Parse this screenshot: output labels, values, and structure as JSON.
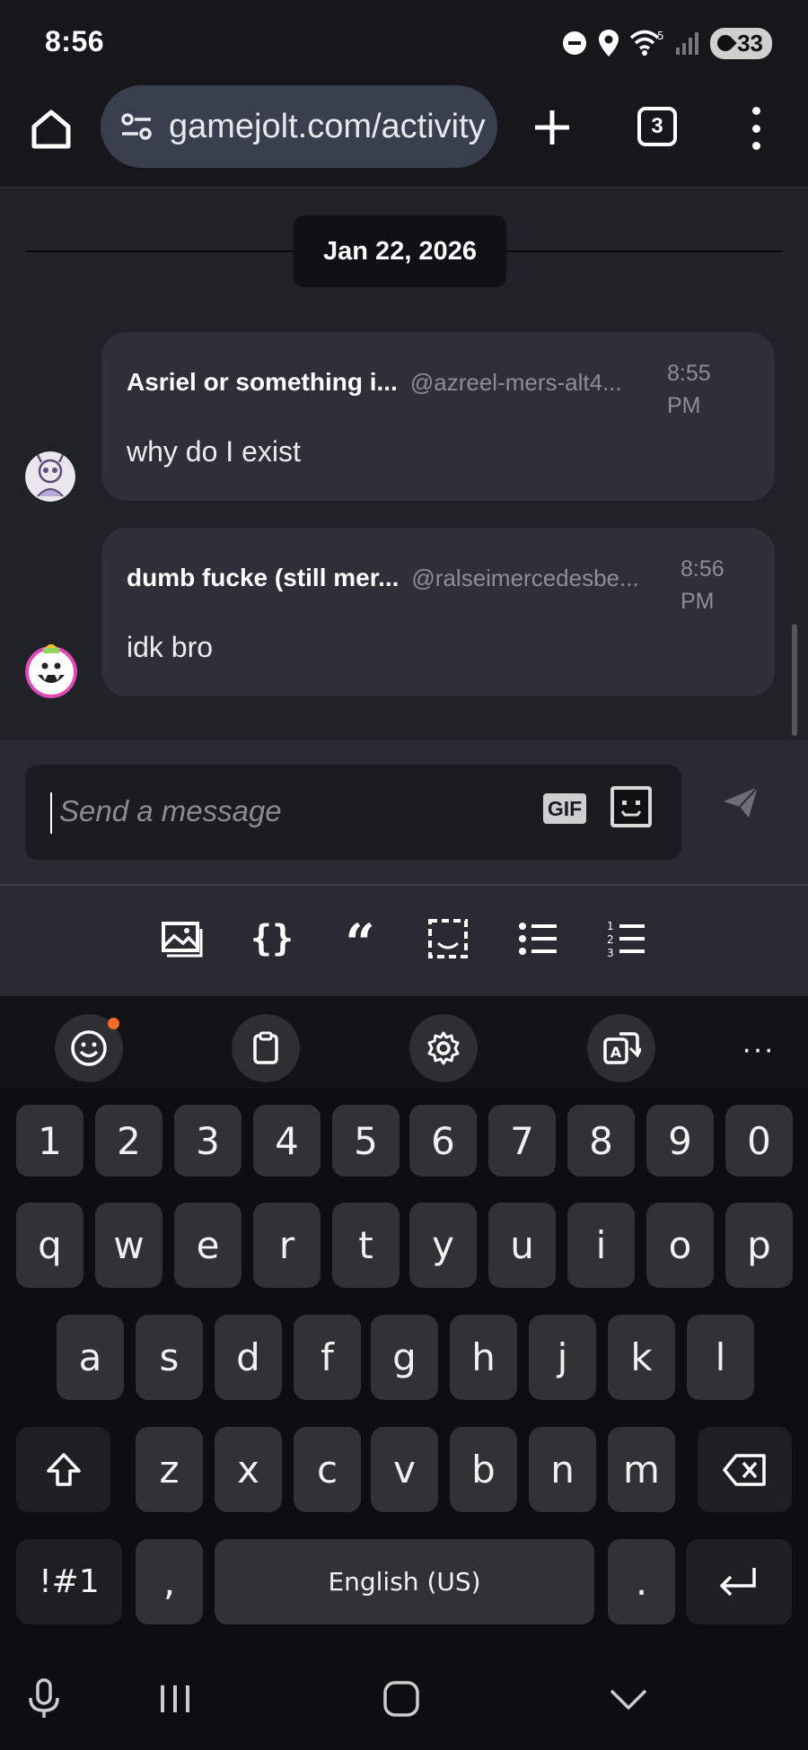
{
  "status_bar": {
    "time": "8:56",
    "battery": "33",
    "wifi_label": "5"
  },
  "browser": {
    "url": "gamejolt.com/activity",
    "tab_count": "3"
  },
  "chat": {
    "date": "Jan 22, 2026",
    "messages": [
      {
        "name": "Asriel or something i...",
        "handle": "@azreel-mers-alt4...",
        "time": "8:55 PM",
        "text": "why do I exist"
      },
      {
        "name": "dumb fucke (still mer...",
        "handle": "@ralseimercedesbe...",
        "time": "8:56 PM",
        "text": "idk bro"
      }
    ]
  },
  "composer": {
    "placeholder": "Send a message",
    "gif_label": "GIF"
  },
  "keyboard": {
    "number_row": [
      "1",
      "2",
      "3",
      "4",
      "5",
      "6",
      "7",
      "8",
      "9",
      "0"
    ],
    "row1": [
      "q",
      "w",
      "e",
      "r",
      "t",
      "y",
      "u",
      "i",
      "o",
      "p"
    ],
    "row2": [
      "a",
      "s",
      "d",
      "f",
      "g",
      "h",
      "j",
      "k",
      "l"
    ],
    "row3": [
      "z",
      "x",
      "c",
      "v",
      "b",
      "n",
      "m"
    ],
    "symbols_key": "!#1",
    "comma_key": ",",
    "space_label": "English (US)",
    "period_key": ".",
    "more_label": "···"
  }
}
